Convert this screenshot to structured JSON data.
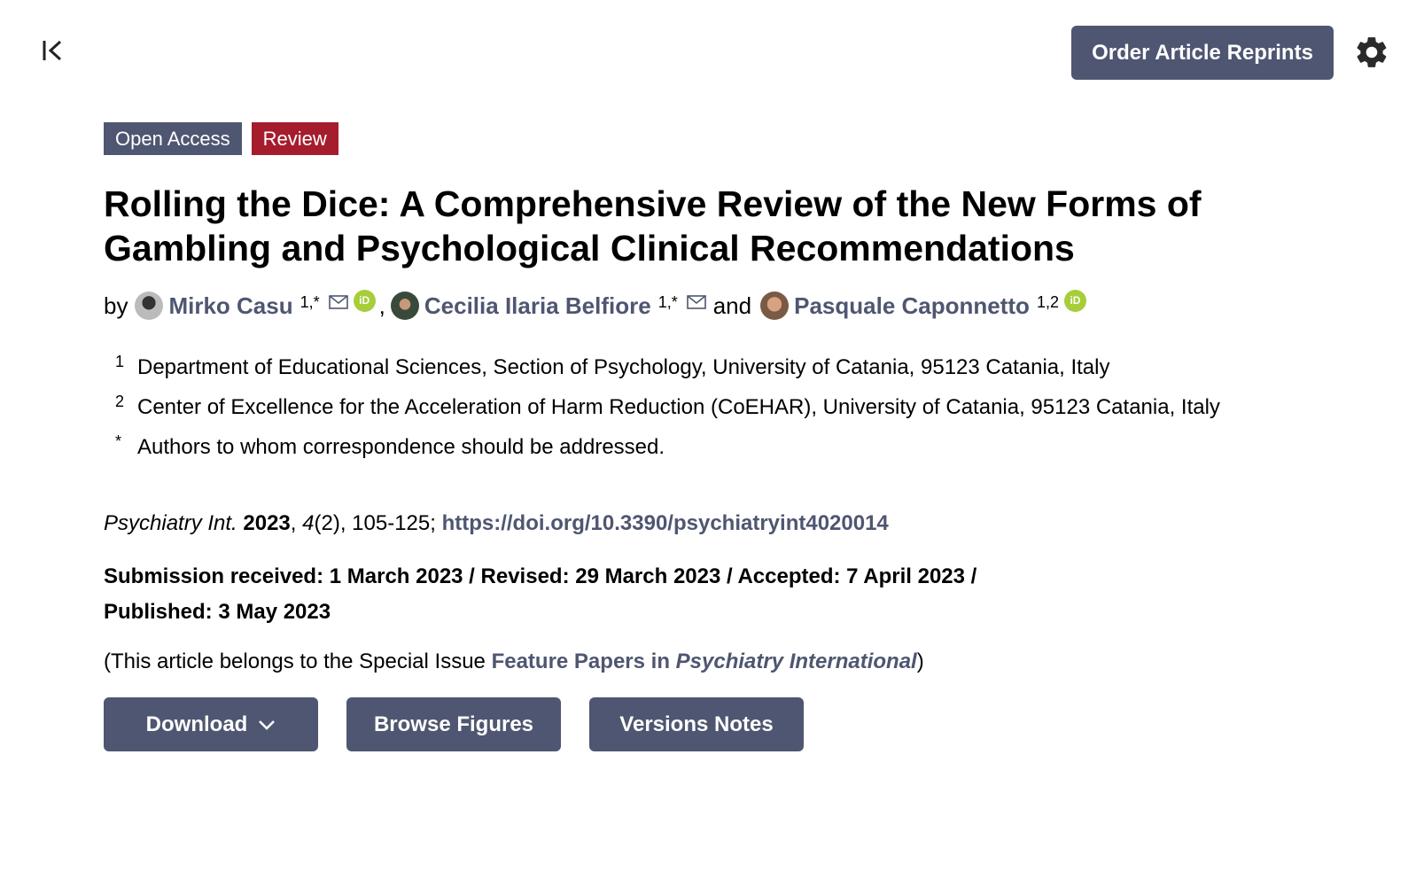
{
  "toolbar": {
    "order_reprints_label": "Order Article Reprints"
  },
  "badges": {
    "open_access": "Open Access",
    "article_type": "Review"
  },
  "article": {
    "title": "Rolling the Dice: A Comprehensive Review of the New Forms of Gambling and Psychological Clinical Recommendations",
    "by_label": "by",
    "and_label": "and",
    "comma": ",",
    "authors": [
      {
        "name": "Mirko Casu",
        "sup": "1,*"
      },
      {
        "name": "Cecilia Ilaria Belfiore",
        "sup": "1,*"
      },
      {
        "name": "Pasquale Caponnetto",
        "sup": "1,2"
      }
    ],
    "affiliations": [
      {
        "num": "1",
        "text": "Department of Educational Sciences, Section of Psychology, University of Catania, 95123 Catania, Italy"
      },
      {
        "num": "2",
        "text": "Center of Excellence for the Acceleration of Harm Reduction (CoEHAR), University of Catania, 95123 Catania, Italy"
      },
      {
        "num": "*",
        "text": "Authors to whom correspondence should be addressed."
      }
    ],
    "citation": {
      "journal": "Psychiatry Int.",
      "year": "2023",
      "volume": "4",
      "issue_pages": "(2), 105-125;",
      "doi": "https://doi.org/10.3390/psychiatryint4020014"
    },
    "dates": "Submission received: 1 March 2023 / Revised: 29 March 2023 / Accepted: 7 April 2023 / Published: 3 May 2023",
    "special_issue": {
      "prefix": "(This article belongs to the Special Issue ",
      "link_plain": "Feature Papers in ",
      "link_italic": "Psychiatry International",
      "suffix": ")"
    }
  },
  "actions": {
    "download": "Download",
    "browse_figures": "Browse Figures",
    "versions_notes": "Versions Notes"
  },
  "icons": {
    "orcid": "iD"
  },
  "colors": {
    "primary": "#4f5671",
    "review_badge": "#a51d2d",
    "orcid": "#a6ce39"
  }
}
